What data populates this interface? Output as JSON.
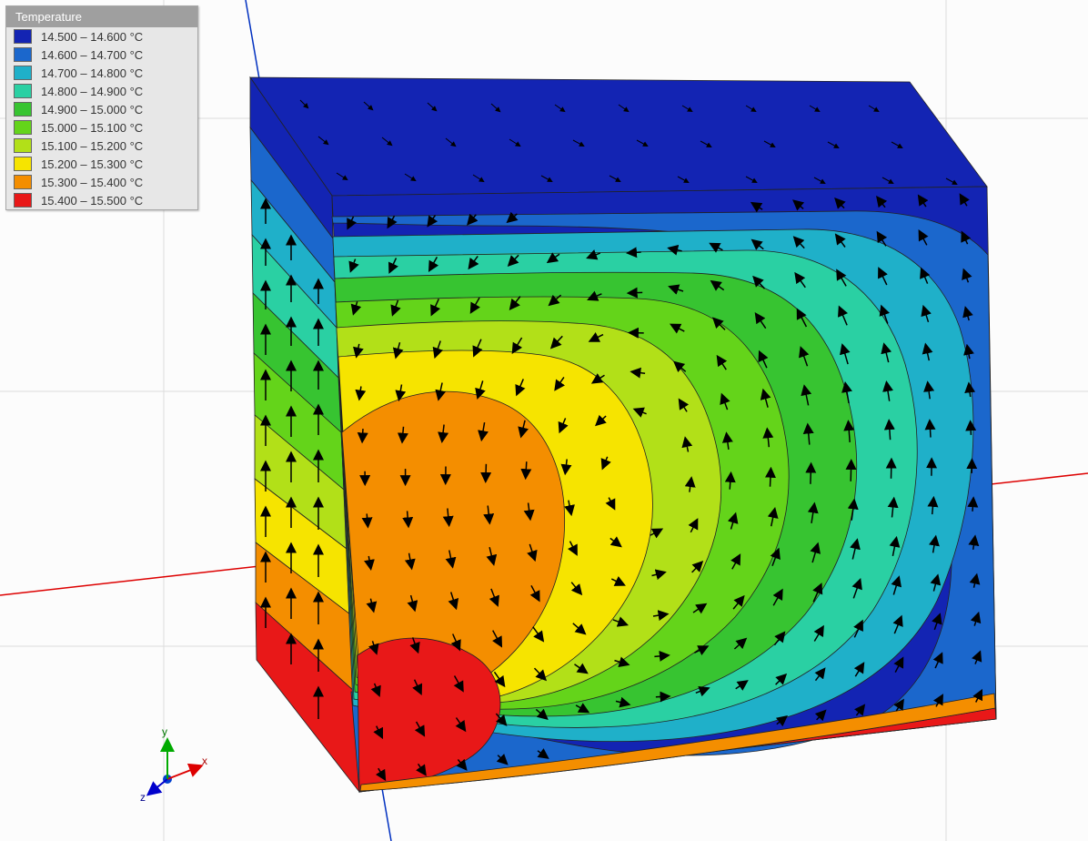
{
  "legend": {
    "title": "Temperature",
    "items": [
      {
        "color": "#1324b3",
        "label": "14.500 – 14.600 °C"
      },
      {
        "color": "#1b67cc",
        "label": "14.600 – 14.700 °C"
      },
      {
        "color": "#1fb0c9",
        "label": "14.700 – 14.800 °C"
      },
      {
        "color": "#2ad0a3",
        "label": "14.800 – 14.900 °C"
      },
      {
        "color": "#37c431",
        "label": "14.900 – 15.000 °C"
      },
      {
        "color": "#64d41a",
        "label": "15.000 – 15.100 °C"
      },
      {
        "color": "#b2e018",
        "label": "15.100 – 15.200 °C"
      },
      {
        "color": "#f6e400",
        "label": "15.200 – 15.300 °C"
      },
      {
        "color": "#f48e00",
        "label": "15.300 – 15.400 °C"
      },
      {
        "color": "#e81818",
        "label": "15.400 – 15.500 °C"
      }
    ]
  },
  "orientation": {
    "x_axis_label": "x",
    "y_axis_label": "y",
    "z_axis_label": "z"
  },
  "chart_data": {
    "type": "heatmap",
    "title": "Temperature",
    "variable": "Temperature",
    "unit": "°C",
    "value_range": [
      14.5,
      15.5
    ],
    "color_scale": [
      {
        "min": 14.5,
        "max": 14.6,
        "color": "#1324b3"
      },
      {
        "min": 14.6,
        "max": 14.7,
        "color": "#1b67cc"
      },
      {
        "min": 14.7,
        "max": 14.8,
        "color": "#1fb0c9"
      },
      {
        "min": 14.8,
        "max": 14.9,
        "color": "#2ad0a3"
      },
      {
        "min": 14.9,
        "max": 15.0,
        "color": "#37c431"
      },
      {
        "min": 15.0,
        "max": 15.1,
        "color": "#64d41a"
      },
      {
        "min": 15.1,
        "max": 15.2,
        "color": "#b2e018"
      },
      {
        "min": 15.2,
        "max": 15.3,
        "color": "#f6e400"
      },
      {
        "min": 15.3,
        "max": 15.4,
        "color": "#f48e00"
      },
      {
        "min": 15.4,
        "max": 15.5,
        "color": "#e81818"
      }
    ],
    "geometry": "cube",
    "notes": "3D scalar temperature field on cube surfaces with overlaid velocity-vector arrows showing a convection cell: upward flow on the hot (left) side, rightward along the top, downward on the cool (right) side, and leftward return along the bottom.",
    "faces": {
      "top": {
        "approx_temperature": 14.55,
        "band": "14.500 – 14.600 °C"
      },
      "left": {
        "gradient": "vertical",
        "top_temperature": 14.55,
        "bottom_temperature": 15.45
      },
      "front": {
        "left_edge_temperature": 15.25,
        "right_edge_temperature": 14.75,
        "top_edge_temperature": 14.55,
        "bottom_edge_temperature": 15.45
      }
    },
    "vector_field": {
      "type": "circulation",
      "description": "Clockwise convection roll on the front face (viewed from outside): up near x≈0.2, across the top toward +x, down near x≈0.9, back toward −x near the bottom.",
      "samples_front": [
        {
          "x": 0.2,
          "y": 0.1,
          "ux": 0.05,
          "uy": 0.95
        },
        {
          "x": 0.2,
          "y": 0.5,
          "ux": 0.0,
          "uy": 1.0
        },
        {
          "x": 0.2,
          "y": 0.85,
          "ux": 0.6,
          "uy": 0.4
        },
        {
          "x": 0.5,
          "y": 0.9,
          "ux": 0.95,
          "uy": 0.05
        },
        {
          "x": 0.8,
          "y": 0.85,
          "ux": 0.5,
          "uy": -0.5
        },
        {
          "x": 0.9,
          "y": 0.5,
          "ux": 0.0,
          "uy": -1.0
        },
        {
          "x": 0.85,
          "y": 0.15,
          "ux": -0.5,
          "uy": -0.5
        },
        {
          "x": 0.55,
          "y": 0.08,
          "ux": -0.95,
          "uy": -0.05
        },
        {
          "x": 0.5,
          "y": 0.5,
          "ux": 0.4,
          "uy": 0.3
        },
        {
          "x": 0.65,
          "y": 0.65,
          "ux": 0.5,
          "uy": 0.0
        },
        {
          "x": 0.65,
          "y": 0.35,
          "ux": -0.3,
          "uy": 0.2
        }
      ]
    }
  }
}
